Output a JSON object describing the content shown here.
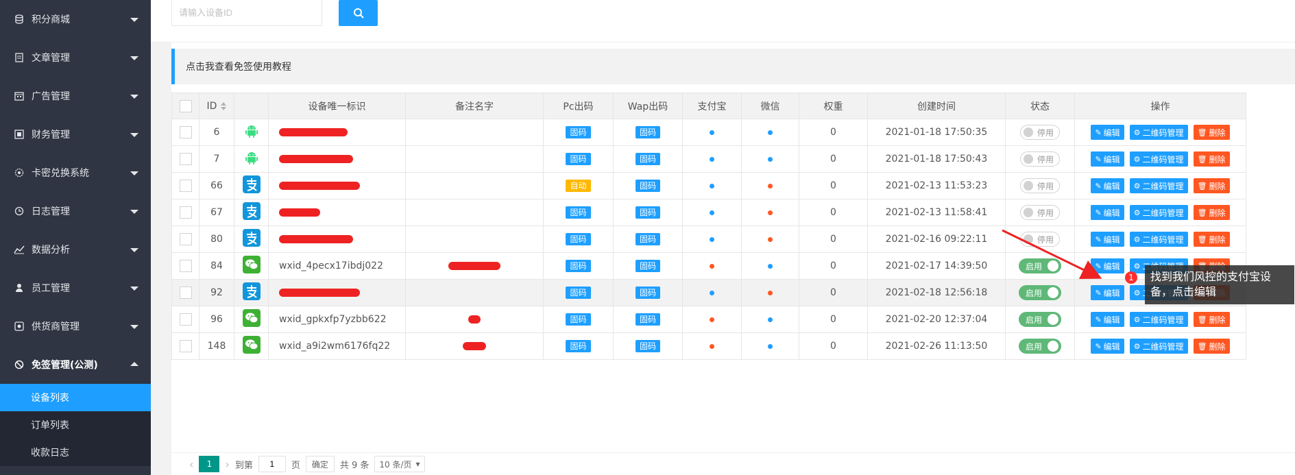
{
  "sidebar": {
    "items": [
      {
        "label": "积分商城",
        "icon": "database-icon"
      },
      {
        "label": "文章管理",
        "icon": "document-icon"
      },
      {
        "label": "广告管理",
        "icon": "calendar-icon"
      },
      {
        "label": "财务管理",
        "icon": "finance-icon"
      },
      {
        "label": "卡密兑换系统",
        "icon": "gear-icon"
      },
      {
        "label": "日志管理",
        "icon": "clock-icon"
      },
      {
        "label": "数据分析",
        "icon": "chart-icon"
      },
      {
        "label": "员工管理",
        "icon": "user-icon"
      },
      {
        "label": "供货商管理",
        "icon": "supplier-icon"
      },
      {
        "label": "免签管理(公测)",
        "icon": "ban-icon"
      }
    ],
    "sub_items": [
      "设备列表",
      "订单列表",
      "收款日志"
    ]
  },
  "search": {
    "placeholder": "请输入设备ID"
  },
  "notice": "点击我查看免签使用教程",
  "table": {
    "headers": [
      "ID",
      "设备唯一标识",
      "备注名字",
      "Pc出码",
      "Wap出码",
      "支付宝",
      "微信",
      "权重",
      "创建时间",
      "状态",
      "操作"
    ],
    "rows": [
      {
        "id": "6",
        "type": "android",
        "ident": "",
        "remark": "",
        "pc": "固码",
        "wap": "固码",
        "ali": "blue",
        "wx": "blue",
        "weight": "0",
        "time": "2021-01-18 17:50:35",
        "status": "off",
        "status_label": "停用"
      },
      {
        "id": "7",
        "type": "android",
        "ident": "",
        "remark": "",
        "pc": "固码",
        "wap": "固码",
        "ali": "blue",
        "wx": "blue",
        "weight": "0",
        "time": "2021-01-18 17:50:43",
        "status": "off",
        "status_label": "停用"
      },
      {
        "id": "66",
        "type": "alipay",
        "ident": "",
        "remark": "",
        "pc": "自动",
        "wap": "固码",
        "ali": "blue",
        "wx": "red",
        "weight": "0",
        "time": "2021-02-13 11:53:23",
        "status": "off",
        "status_label": "停用"
      },
      {
        "id": "67",
        "type": "alipay",
        "ident": "",
        "remark": "",
        "pc": "固码",
        "wap": "固码",
        "ali": "blue",
        "wx": "red",
        "weight": "0",
        "time": "2021-02-13 11:58:41",
        "status": "off",
        "status_label": "停用"
      },
      {
        "id": "80",
        "type": "alipay",
        "ident": "",
        "remark": "",
        "pc": "固码",
        "wap": "固码",
        "ali": "blue",
        "wx": "red",
        "weight": "0",
        "time": "2021-02-16 09:22:11",
        "status": "off",
        "status_label": "停用"
      },
      {
        "id": "84",
        "type": "wechat",
        "ident": "wxid_4pecx17ibdj022",
        "remark": "",
        "pc": "固码",
        "wap": "固码",
        "ali": "red",
        "wx": "blue",
        "weight": "0",
        "time": "2021-02-17 14:39:50",
        "status": "on",
        "status_label": "启用"
      },
      {
        "id": "92",
        "type": "alipay",
        "ident": "",
        "remark": "",
        "pc": "固码",
        "wap": "固码",
        "ali": "blue",
        "wx": "red",
        "weight": "0",
        "time": "2021-02-18 12:56:18",
        "status": "on",
        "status_label": "启用"
      },
      {
        "id": "96",
        "type": "wechat",
        "ident": "wxid_gpkxfp7yzbb622",
        "remark": "",
        "pc": "固码",
        "wap": "固码",
        "ali": "red",
        "wx": "blue",
        "weight": "0",
        "time": "2021-02-20 12:37:04",
        "status": "on",
        "status_label": "启用"
      },
      {
        "id": "148",
        "type": "wechat",
        "ident": "wxid_a9i2wm6176fq22",
        "remark": "",
        "pc": "固码",
        "wap": "固码",
        "ali": "red",
        "wx": "blue",
        "weight": "0",
        "time": "2021-02-26 11:13:50",
        "status": "on",
        "status_label": "启用"
      }
    ],
    "actions": {
      "edit": "编辑",
      "qr": "二维码管理",
      "delete": "删除"
    }
  },
  "pager": {
    "page": "1",
    "goto": "到第",
    "unit": "页",
    "confirm": "确定",
    "total": "共 9 条",
    "per_page": "10 条/页"
  },
  "annotation": {
    "badge": "1",
    "text": "找到我们风控的支付宝设备，点击编辑"
  },
  "colors": {
    "sidebar": "#2f3542",
    "accent": "#1e9fff",
    "danger": "#ff5722",
    "warn": "#ffb800",
    "on": "#5fb878",
    "dot_blue": "#1e9fff",
    "dot_red": "#ff5722",
    "android": "#3ddc84",
    "alipay": "#1296db",
    "wechat": "#3eb135"
  }
}
